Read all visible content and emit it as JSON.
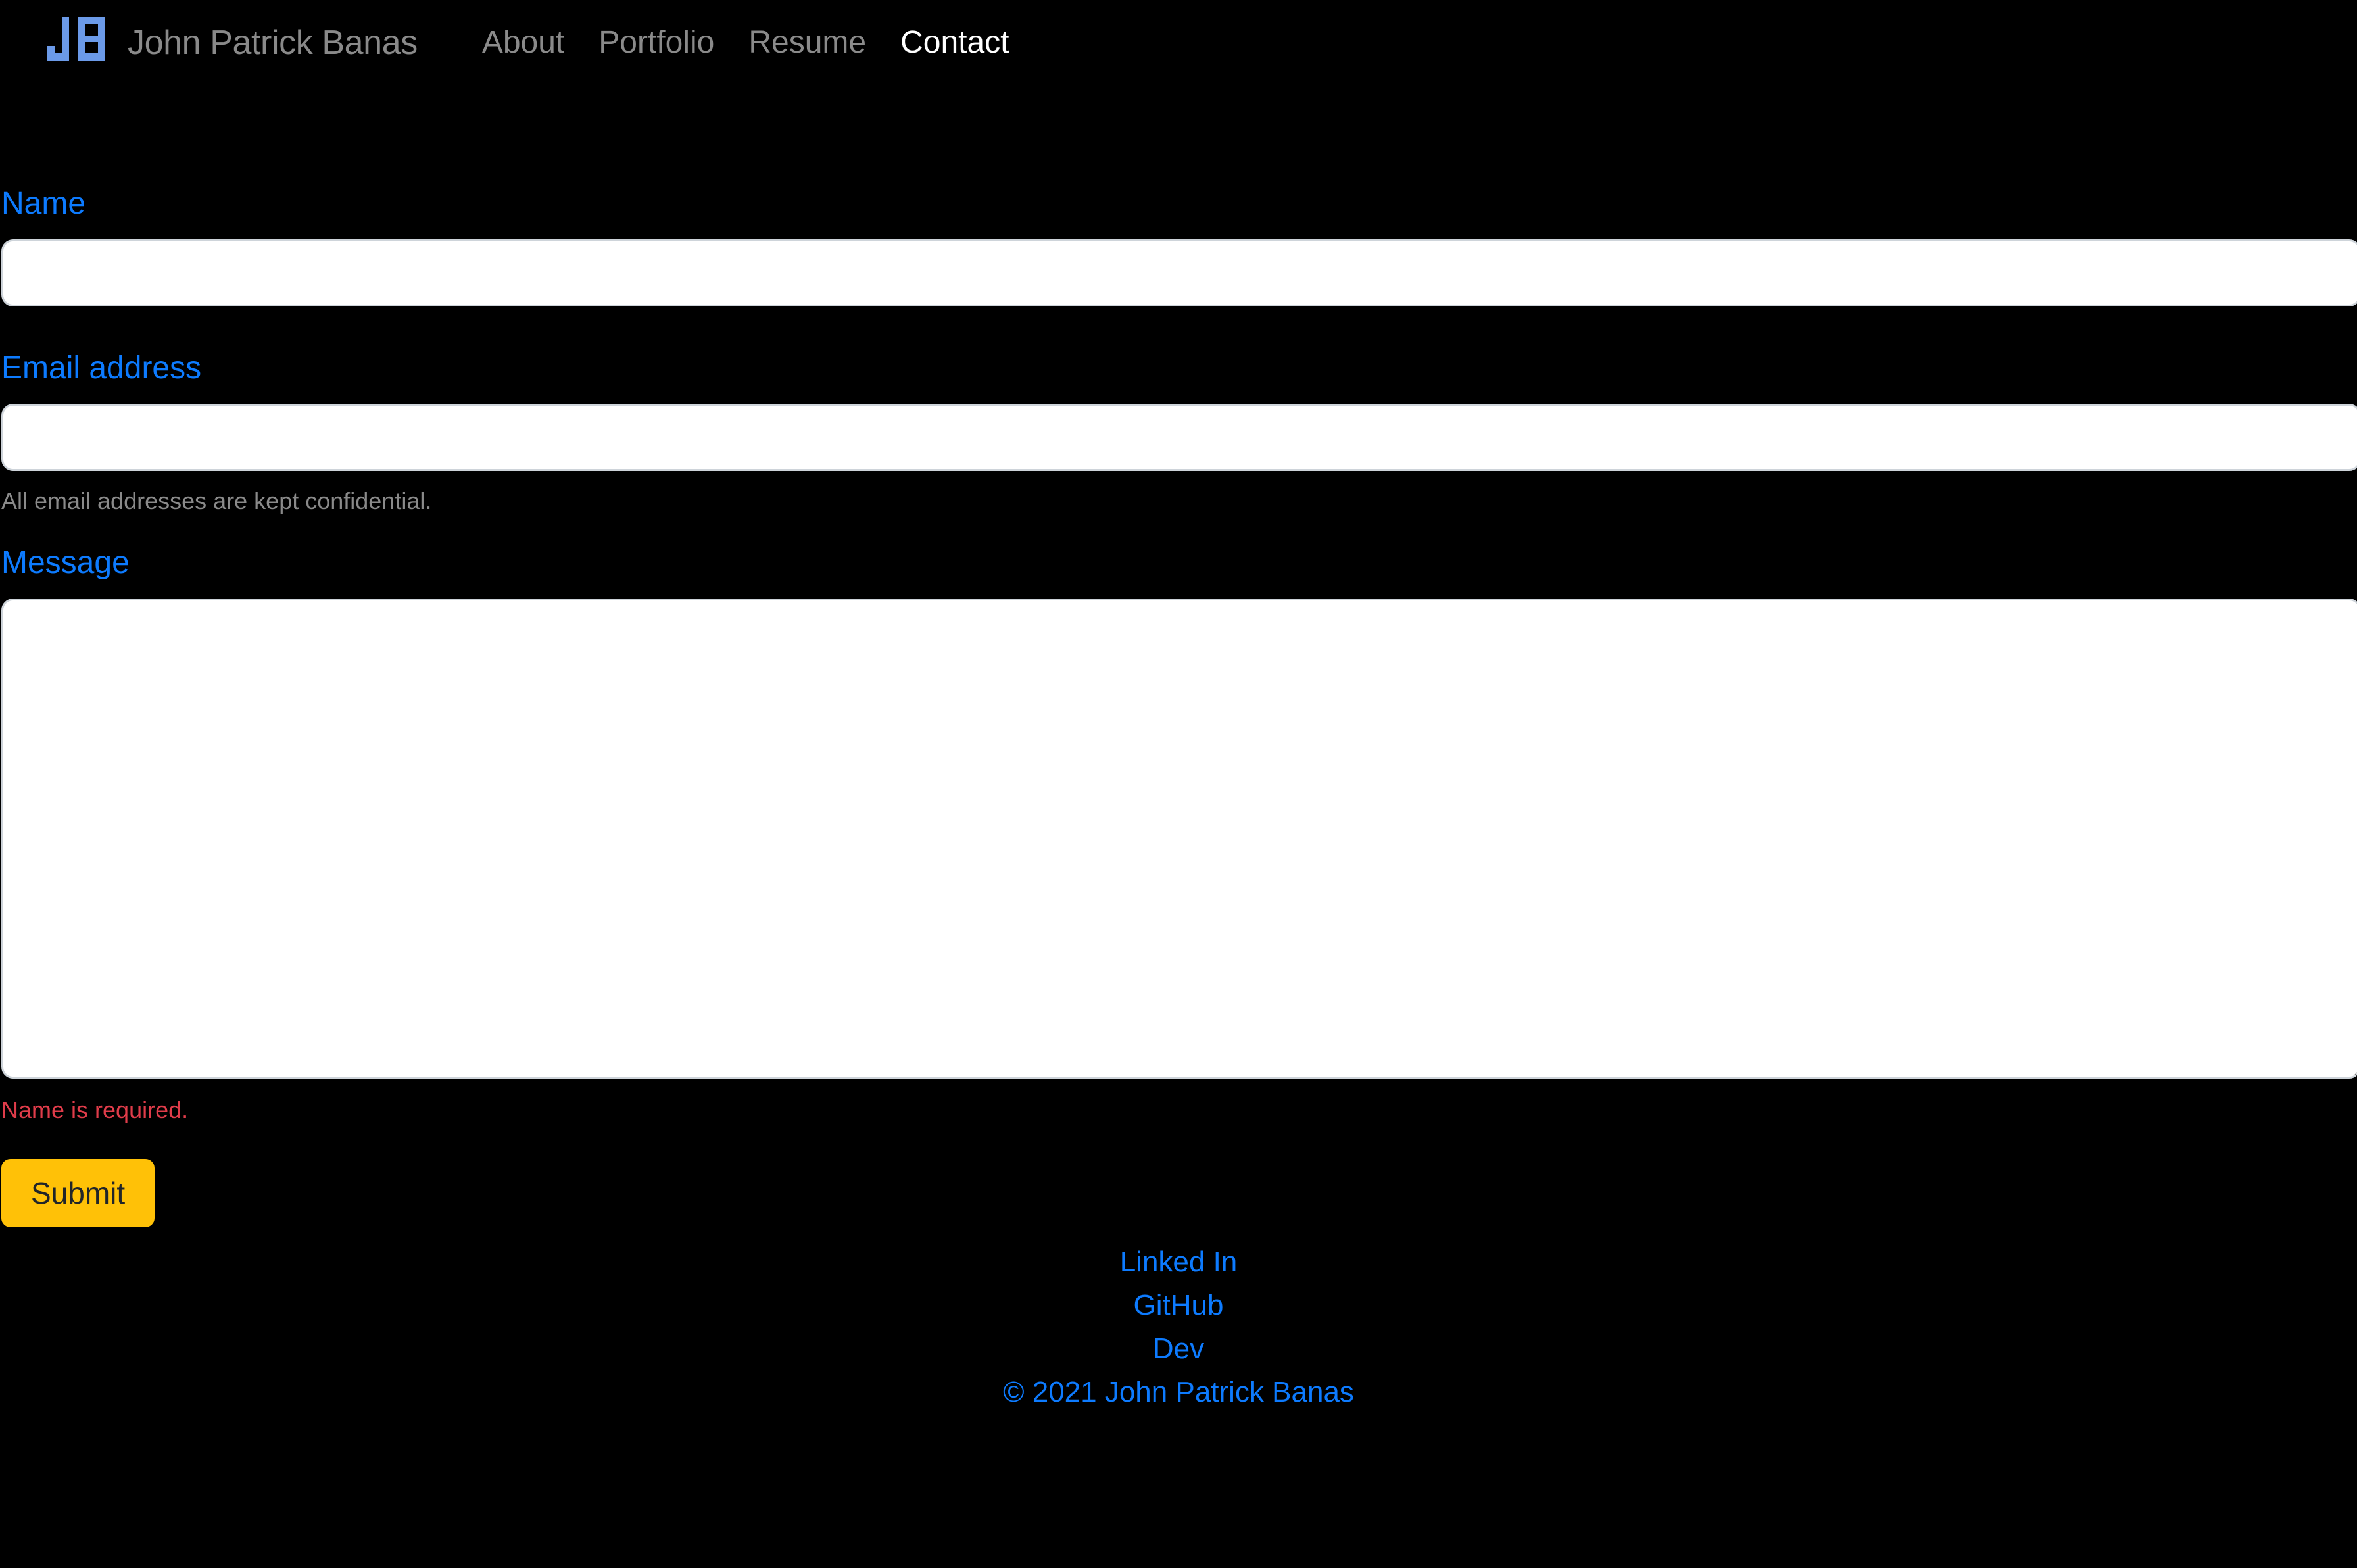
{
  "page": {
    "background_color": "#000000",
    "accent_blue": "#0d7bff",
    "logo_blue": "#6b9ae8",
    "muted_gray": "#8a8a8a",
    "error_red": "#e03c4a",
    "submit_amber": "#ffc107"
  },
  "navbar": {
    "logo_text": "JB",
    "brand_name": "John Patrick Banas",
    "links": [
      {
        "label": "About",
        "active": false
      },
      {
        "label": "Portfolio",
        "active": false
      },
      {
        "label": "Resume",
        "active": false
      },
      {
        "label": "Contact",
        "active": true
      }
    ]
  },
  "form": {
    "name": {
      "label": "Name",
      "value": "",
      "placeholder": ""
    },
    "email": {
      "label": "Email address",
      "value": "",
      "placeholder": "",
      "help_text": "All email addresses are kept confidential."
    },
    "message": {
      "label": "Message",
      "value": "",
      "placeholder": ""
    },
    "error": "Name is required.",
    "submit_label": "Submit"
  },
  "footer": {
    "links": [
      {
        "label": "Linked In"
      },
      {
        "label": "GitHub"
      },
      {
        "label": "Dev"
      }
    ],
    "copyright": "© 2021 John Patrick Banas"
  }
}
